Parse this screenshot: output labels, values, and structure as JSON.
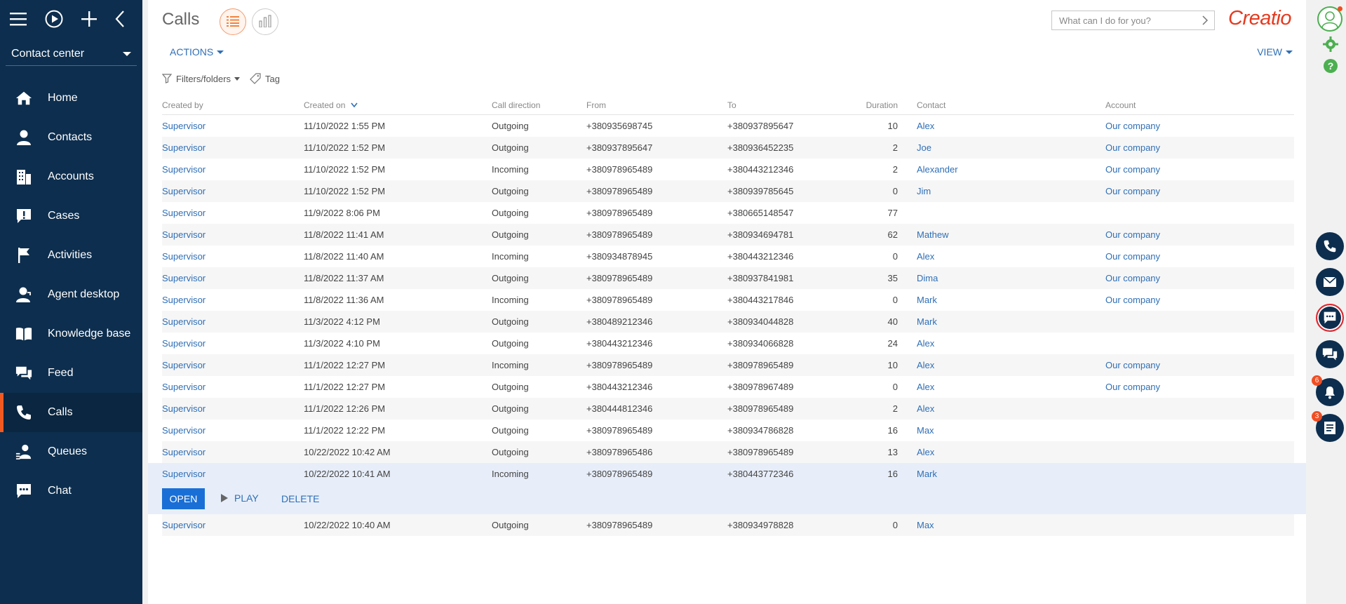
{
  "sidebar": {
    "workspace": "Contact center",
    "items": [
      {
        "label": "Home",
        "icon": "home-icon"
      },
      {
        "label": "Contacts",
        "icon": "person-icon"
      },
      {
        "label": "Accounts",
        "icon": "building-icon"
      },
      {
        "label": "Cases",
        "icon": "case-alert-icon"
      },
      {
        "label": "Activities",
        "icon": "flag-icon"
      },
      {
        "label": "Agent desktop",
        "icon": "agent-icon"
      },
      {
        "label": "Knowledge base",
        "icon": "book-icon"
      },
      {
        "label": "Feed",
        "icon": "feed-icon"
      },
      {
        "label": "Calls",
        "icon": "phone-icon",
        "active": true
      },
      {
        "label": "Queues",
        "icon": "queue-icon"
      },
      {
        "label": "Chat",
        "icon": "chat-icon"
      }
    ]
  },
  "header": {
    "title": "Calls",
    "search_placeholder": "What can I do for you?",
    "logo": "Creatio",
    "actions_label": "ACTIONS",
    "view_label": "VIEW",
    "filters_label": "Filters/folders",
    "tag_label": "Tag"
  },
  "grid": {
    "columns": [
      "Created by",
      "Created on",
      "Call direction",
      "From",
      "To",
      "Duration",
      "Contact",
      "Account"
    ],
    "rows": [
      {
        "by": "Supervisor",
        "on": "11/10/2022 1:55 PM",
        "dir": "Outgoing",
        "from": "+380935698745",
        "to": "+380937895647",
        "dur": "10",
        "contact": "Alex",
        "account": "Our company"
      },
      {
        "by": "Supervisor",
        "on": "11/10/2022 1:52 PM",
        "dir": "Outgoing",
        "from": "+380937895647",
        "to": "+380936452235",
        "dur": "2",
        "contact": "Joe",
        "account": "Our company"
      },
      {
        "by": "Supervisor",
        "on": "11/10/2022 1:52 PM",
        "dir": "Incoming",
        "from": "+380978965489",
        "to": "+380443212346",
        "dur": "2",
        "contact": "Alexander",
        "account": "Our company"
      },
      {
        "by": "Supervisor",
        "on": "11/10/2022 1:52 PM",
        "dir": "Outgoing",
        "from": "+380978965489",
        "to": "+380939785645",
        "dur": "0",
        "contact": "Jim",
        "account": "Our company"
      },
      {
        "by": "Supervisor",
        "on": "11/9/2022 8:06 PM",
        "dir": "Outgoing",
        "from": "+380978965489",
        "to": "+380665148547",
        "dur": "77",
        "contact": "",
        "account": ""
      },
      {
        "by": "Supervisor",
        "on": "11/8/2022 11:41 AM",
        "dir": "Outgoing",
        "from": "+380978965489",
        "to": "+380934694781",
        "dur": "62",
        "contact": "Mathew",
        "account": "Our company"
      },
      {
        "by": "Supervisor",
        "on": "11/8/2022 11:40 AM",
        "dir": "Incoming",
        "from": "+380934878945",
        "to": "+380443212346",
        "dur": "0",
        "contact": "Alex",
        "account": "Our company"
      },
      {
        "by": "Supervisor",
        "on": "11/8/2022 11:37 AM",
        "dir": "Outgoing",
        "from": "+380978965489",
        "to": "+380937841981",
        "dur": "35",
        "contact": "Dima",
        "account": "Our company"
      },
      {
        "by": "Supervisor",
        "on": "11/8/2022 11:36 AM",
        "dir": "Incoming",
        "from": "+380978965489",
        "to": "+380443217846",
        "dur": "0",
        "contact": "Mark",
        "account": "Our company"
      },
      {
        "by": "Supervisor",
        "on": "11/3/2022 4:12 PM",
        "dir": "Outgoing",
        "from": "+380489212346",
        "to": "+380934044828",
        "dur": "40",
        "contact": "Mark",
        "account": ""
      },
      {
        "by": "Supervisor",
        "on": "11/3/2022 4:10 PM",
        "dir": "Outgoing",
        "from": "+380443212346",
        "to": "+380934066828",
        "dur": "24",
        "contact": "Alex",
        "account": ""
      },
      {
        "by": "Supervisor",
        "on": "11/1/2022 12:27 PM",
        "dir": "Incoming",
        "from": "+380978965489",
        "to": "+380978965489",
        "dur": "10",
        "contact": "Alex",
        "account": "Our company"
      },
      {
        "by": "Supervisor",
        "on": "11/1/2022 12:27 PM",
        "dir": "Outgoing",
        "from": "+380443212346",
        "to": "+380978967489",
        "dur": "0",
        "contact": "Alex",
        "account": "Our company"
      },
      {
        "by": "Supervisor",
        "on": "11/1/2022 12:26 PM",
        "dir": "Outgoing",
        "from": "+380444812346",
        "to": "+380978965489",
        "dur": "2",
        "contact": "Alex",
        "account": ""
      },
      {
        "by": "Supervisor",
        "on": "11/1/2022 12:22 PM",
        "dir": "Outgoing",
        "from": "+380978965489",
        "to": "+380934786828",
        "dur": "16",
        "contact": "Max",
        "account": ""
      },
      {
        "by": "Supervisor",
        "on": "10/22/2022 10:42 AM",
        "dir": "Outgoing",
        "from": "+380978965486",
        "to": "+380978965489",
        "dur": "13",
        "contact": "Alex",
        "account": ""
      },
      {
        "by": "Supervisor",
        "on": "10/22/2022 10:41 AM",
        "dir": "Incoming",
        "from": "+380978965489",
        "to": "+380443772346",
        "dur": "16",
        "contact": "Mark",
        "account": "",
        "selected": true
      },
      {
        "by": "Supervisor",
        "on": "10/22/2022 10:40 AM",
        "dir": "Outgoing",
        "from": "+380978965489",
        "to": "+380934978828",
        "dur": "0",
        "contact": "Max",
        "account": ""
      }
    ],
    "row_actions": {
      "open": "OPEN",
      "play": "PLAY",
      "delete": "DELETE"
    }
  },
  "rail": {
    "notifications_count": "6",
    "tasks_count": "3"
  },
  "colors": {
    "sidebar": "#0d2e4e",
    "accent": "#f05a22",
    "link": "#2f6fb6",
    "primary_button": "#1a6fd6"
  }
}
